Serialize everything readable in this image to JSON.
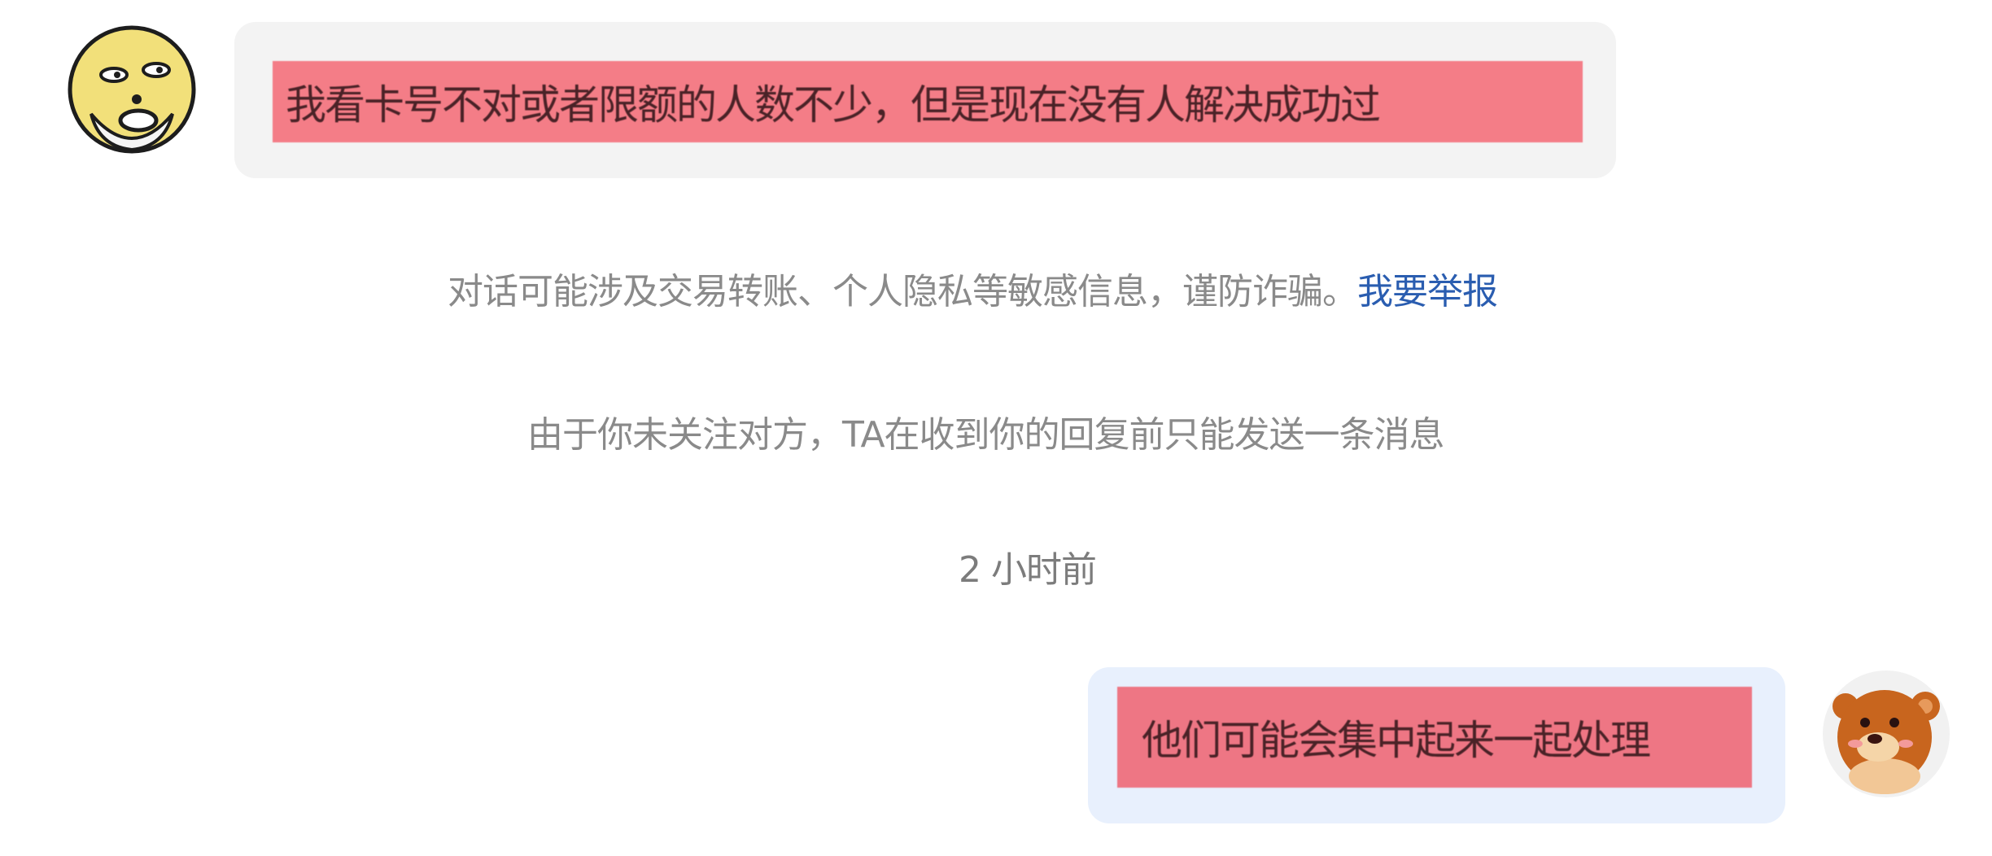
{
  "messages": [
    {
      "side": "left",
      "avatar": "cartoon-face-icon",
      "text": "我看卡号不对或者限额的人数不少，但是现在没有人解决成功过"
    },
    {
      "side": "right",
      "avatar": "bear-avatar-icon",
      "text": "他们可能会集中起来一起处理"
    }
  ],
  "notices": {
    "privacy_warning": "对话可能涉及交易转账、个人隐私等敏感信息，谨防诈骗。",
    "report_link": "我要举报",
    "follow_notice": "由于你未关注对方，TA在收到你的回复前只能发送一条消息"
  },
  "timestamp": "2 小时前",
  "colors": {
    "left_bubble_bg": "#f3f3f3",
    "right_bubble_bg": "#e8f0fd",
    "highlight_left": "#f47d87",
    "highlight_right": "#ee7684",
    "link": "#2a5db0",
    "muted_text": "#8a8a8a"
  }
}
